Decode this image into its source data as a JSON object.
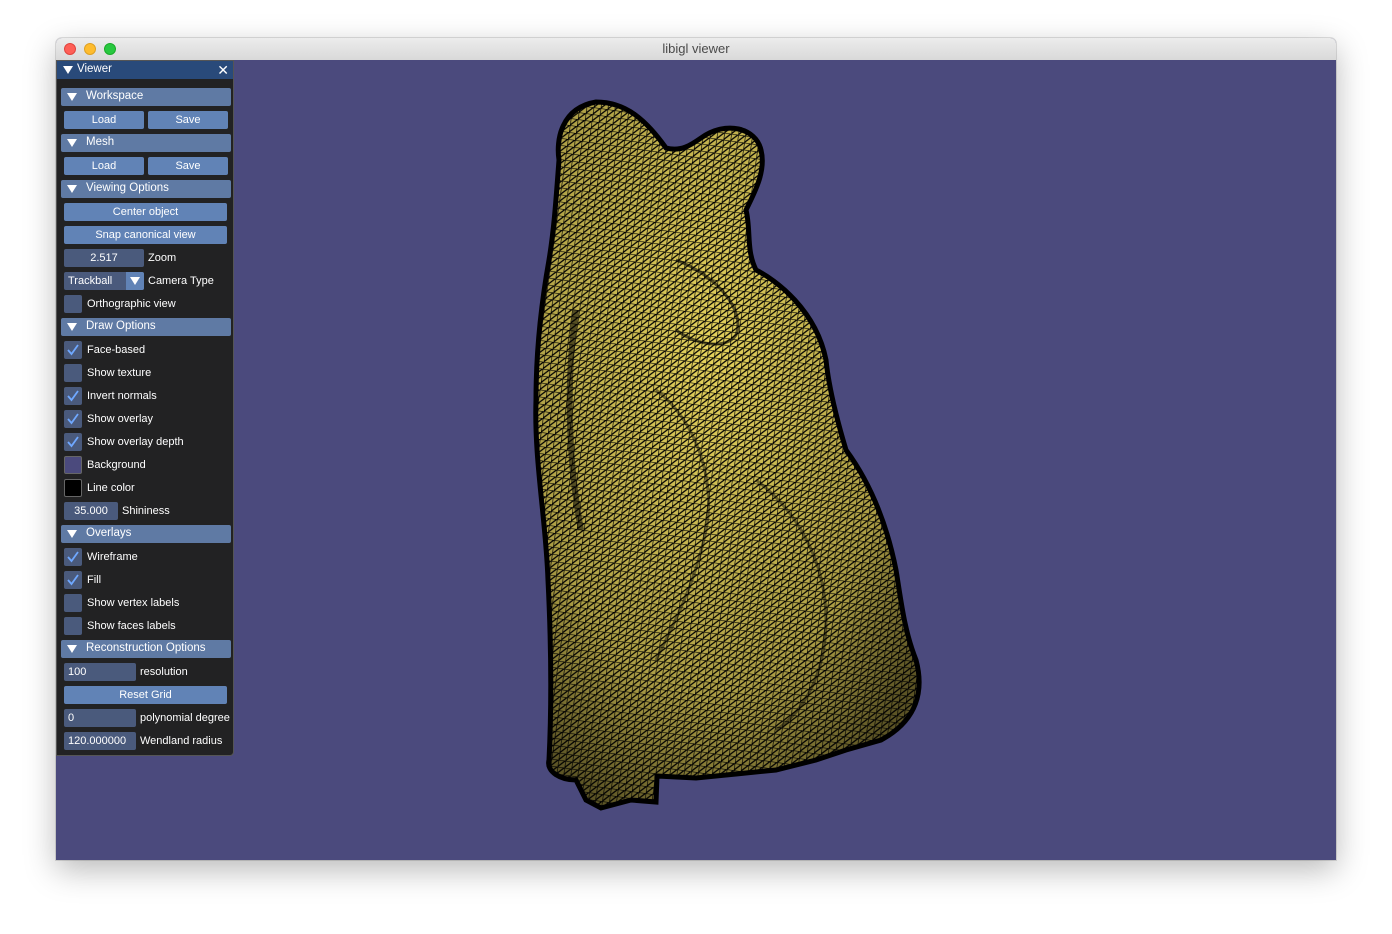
{
  "window": {
    "title": "libigl viewer"
  },
  "panel": {
    "title": "Viewer",
    "sections": {
      "workspace": {
        "label": "Workspace",
        "load": "Load",
        "save": "Save"
      },
      "mesh": {
        "label": "Mesh",
        "load": "Load",
        "save": "Save"
      },
      "viewing": {
        "label": "Viewing Options",
        "center_object": "Center object",
        "snap_canonical": "Snap canonical view",
        "zoom_value": "2.517",
        "zoom_label": "Zoom",
        "camera_type_value": "Trackball",
        "camera_type_label": "Camera Type",
        "orthographic_label": "Orthographic view",
        "orthographic_checked": false
      },
      "draw": {
        "label": "Draw Options",
        "face_based": {
          "label": "Face-based",
          "checked": true
        },
        "show_texture": {
          "label": "Show texture",
          "checked": false
        },
        "invert_normals": {
          "label": "Invert normals",
          "checked": true
        },
        "show_overlay": {
          "label": "Show overlay",
          "checked": true
        },
        "show_overlay_depth": {
          "label": "Show overlay depth",
          "checked": true
        },
        "background": {
          "label": "Background",
          "color": "#4b4a7d"
        },
        "line_color": {
          "label": "Line color",
          "color": "#000000"
        },
        "shininess_value": "35.000",
        "shininess_label": "Shininess"
      },
      "overlays": {
        "label": "Overlays",
        "wireframe": {
          "label": "Wireframe",
          "checked": true
        },
        "fill": {
          "label": "Fill",
          "checked": true
        },
        "show_vertex_labels": {
          "label": "Show vertex labels",
          "checked": false
        },
        "show_faces_labels": {
          "label": "Show faces labels",
          "checked": false
        }
      },
      "reconstruction": {
        "label": "Reconstruction Options",
        "resolution_value": "100",
        "resolution_label": "resolution",
        "reset_grid": "Reset Grid",
        "polynomial_value": "0",
        "polynomial_label": "polynomial degree",
        "wendland_value": "120.000000",
        "wendland_label": "Wendland radius"
      }
    }
  },
  "colors": {
    "viewport_bg": "#4b4a7d",
    "mesh_fill": "#e6d35c",
    "wire": "#000000",
    "checkmark": "#6fa8ff"
  },
  "mesh": {
    "name": "bear-statue-wireframe"
  }
}
